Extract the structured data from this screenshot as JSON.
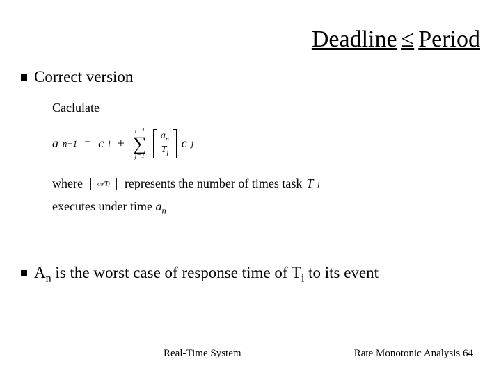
{
  "title": {
    "left": "Deadline",
    "op": "≤",
    "right": "Period"
  },
  "bullets": {
    "correct": "Correct version",
    "an_pre": "A",
    "an_sub": "n",
    "an_post": " is the worst case of response time of T",
    "ti_sub": "i",
    "an_tail": " to its event"
  },
  "math": {
    "calc": "Caclulate",
    "lhs_a": "a",
    "lhs_sub": "n+1",
    "eq": "=",
    "ci_c": "c",
    "ci_sub": "i",
    "plus": "+",
    "sum_top": "i−1",
    "sum_bot": "j=1",
    "frac_num_a": "a",
    "frac_num_sub": "n",
    "frac_den_T": "T",
    "frac_den_sub": "j",
    "cj_c": "c",
    "cj_sub": "j",
    "where": "where",
    "repr": "represents the number of times task ",
    "tj_T": "T",
    "tj_sub": "j",
    "exec": "executes under time ",
    "time_a": "a",
    "time_sub": "n"
  },
  "footer": {
    "left": "Real-Time System",
    "right_label": "Rate Monotonic Analysis ",
    "right_num": "64"
  }
}
